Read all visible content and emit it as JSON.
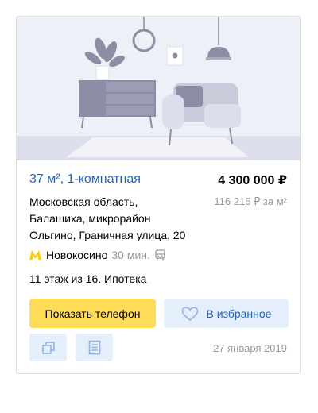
{
  "listing": {
    "title": "37 м², 1-комнатная",
    "price": "4 300 000 ₽",
    "address_lines": [
      "Московская область,",
      "Балашиха, микрорайон",
      "Ольгино, Граничная улица, 20"
    ],
    "price_per_m2": "116 216 ₽ за м²",
    "metro_station": "Новокосино",
    "metro_time": "30 мин.",
    "floor_info": "11 этаж из 16. Ипотека",
    "date": "27 января 2019"
  },
  "actions": {
    "show_phone": "Показать телефон",
    "favorite": "В избранное"
  },
  "icons": {
    "metro": "metro-icon",
    "transport": "bus-icon",
    "favorite": "heart-icon",
    "compare": "copy-icon",
    "notes": "document-icon"
  },
  "colors": {
    "accent": "#1a62c9",
    "phone_button": "#ffdc57",
    "favorite_button": "#e5eefb",
    "metro": "#ffcc00",
    "muted": "#999999"
  }
}
